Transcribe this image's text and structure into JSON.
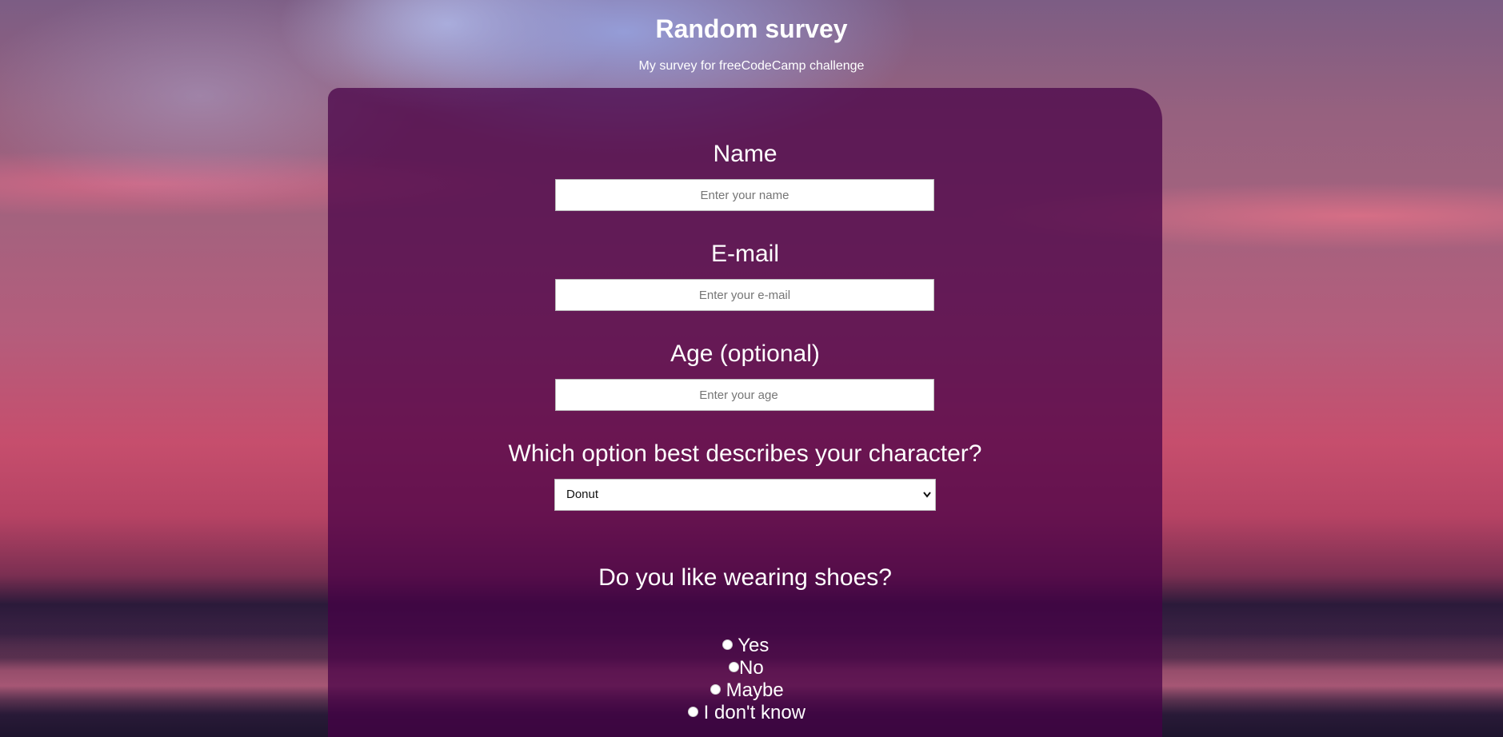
{
  "header": {
    "title": "Random survey",
    "subtitle": "My survey for freeCodeCamp challenge"
  },
  "form": {
    "name": {
      "label": "Name",
      "placeholder": "Enter your name",
      "value": ""
    },
    "email": {
      "label": "E-mail",
      "placeholder": "Enter your e-mail",
      "value": ""
    },
    "age": {
      "label": "Age (optional)",
      "placeholder": "Enter your age",
      "value": ""
    },
    "character": {
      "label": "Which option best describes your character?",
      "selected": "Donut"
    },
    "shoes": {
      "label": "Do you like wearing shoes?",
      "options": [
        "Yes",
        "No",
        "Maybe",
        "I don't know"
      ]
    }
  },
  "colors": {
    "panel": "#46004699",
    "text": "#ffffff",
    "input_bg": "#ffffff"
  },
  "icons": {
    "select_arrow": "chevron-down-icon",
    "radio": "radio-button-icon"
  }
}
